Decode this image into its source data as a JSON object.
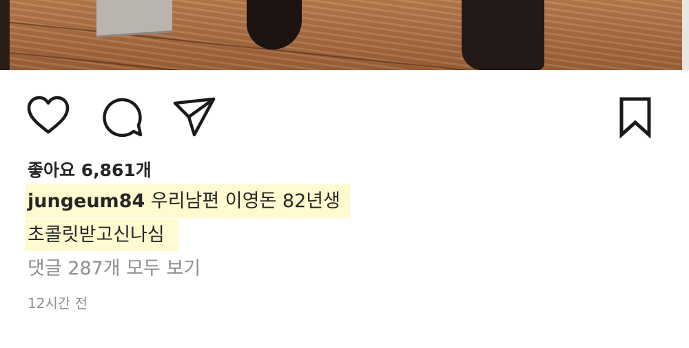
{
  "post": {
    "likes_label": "좋아요 6,861개",
    "username": "jungeum84",
    "caption_line1": " 우리남편 이영돈 82년생",
    "caption_line2": "초콜릿받고신나심",
    "view_comments": "댓글 287개 모두 보기",
    "timestamp": "12시간 전"
  },
  "actions": {
    "icons": [
      "heart-icon",
      "comment-icon",
      "share-icon",
      "bookmark-icon"
    ]
  },
  "colors": {
    "text": "#262626",
    "muted": "#8e8e8e",
    "highlight": "#fff596"
  }
}
